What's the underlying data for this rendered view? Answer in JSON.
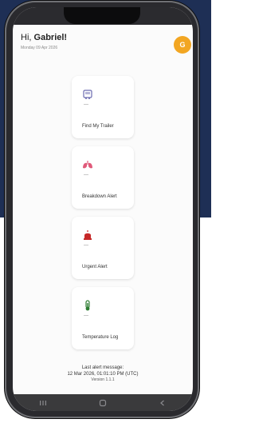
{
  "header": {
    "greeting_prefix": "Hi,",
    "user_name": "Gabriel!",
    "date": "Monday 09 Apr 2026",
    "avatar_initial": "G"
  },
  "cards": [
    {
      "label": "Find My Trailer",
      "icon": "trailer-icon"
    },
    {
      "label": "Breakdown Alert",
      "icon": "lungs-icon"
    },
    {
      "label": "Urgent Alert",
      "icon": "siren-icon"
    },
    {
      "label": "Temperature Log",
      "icon": "thermometer-icon"
    }
  ],
  "footer": {
    "last_alert_label": "Last alert message:",
    "last_alert_time": "12 Mar 2026, 01:01:10 PM (UTC)",
    "version": "Version 1.1.1"
  },
  "nav": {
    "recent_icon": "recent-apps-icon",
    "home_icon": "home-icon",
    "back_icon": "back-icon"
  },
  "colors": {
    "background_panel": "#1e2f55",
    "avatar": "#f2a622",
    "breakdown": "#e05a7a",
    "urgent": "#c62828",
    "temperature": "#2e7d32",
    "trailer": "#6b6bb0"
  }
}
